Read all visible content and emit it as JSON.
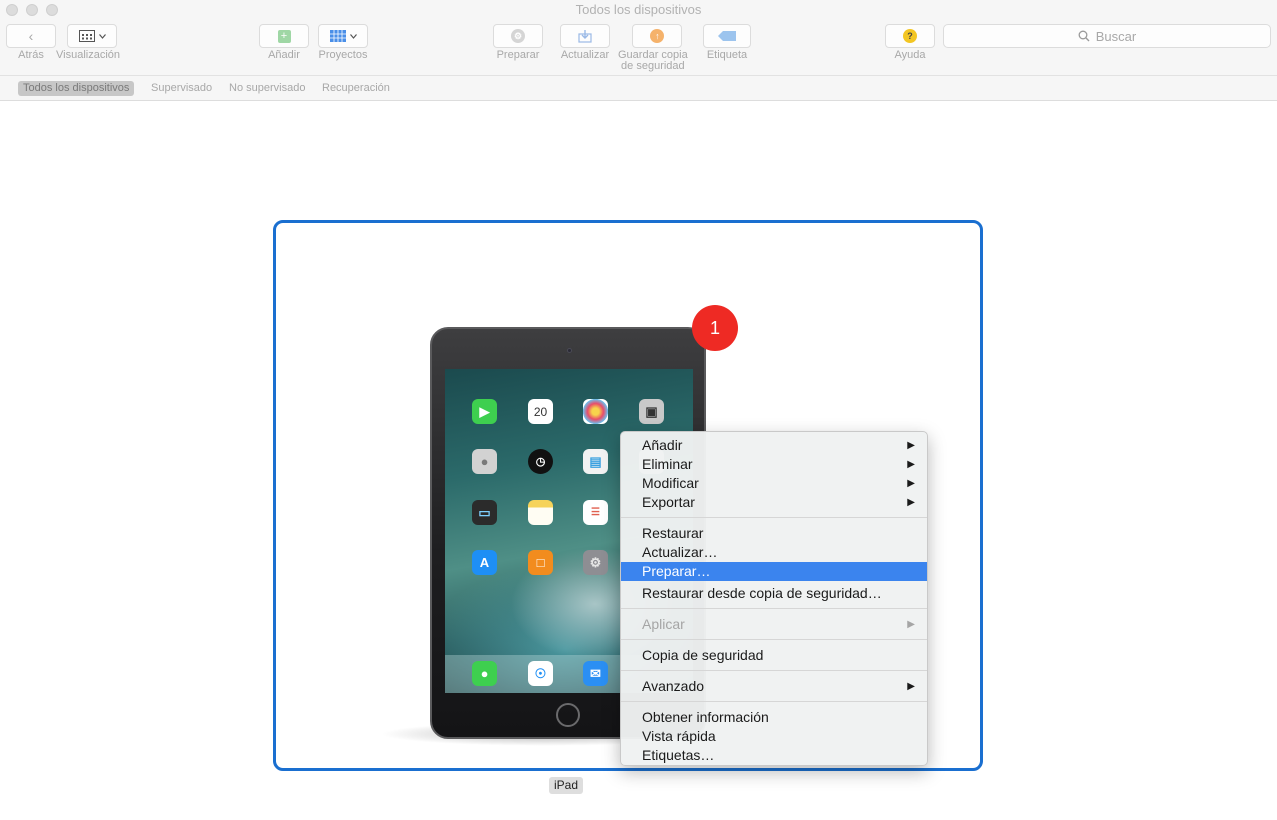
{
  "window": {
    "title": "Todos los dispositivos"
  },
  "toolbar": {
    "back_label": "Atrás",
    "view_label": "Visualización",
    "add_label": "Añadir",
    "projects_label": "Proyectos",
    "prepare_label": "Preparar",
    "update_label": "Actualizar",
    "backup_label_line1": "Guardar copia",
    "backup_label_line2": "de seguridad",
    "tag_label": "Etiqueta",
    "help_label": "Ayuda",
    "help_icon_glyph": "?",
    "search_placeholder": "Buscar"
  },
  "filters": [
    {
      "label": "Todos los dispositivos",
      "active": true
    },
    {
      "label": "Supervisado",
      "active": false
    },
    {
      "label": "No supervisado",
      "active": false
    },
    {
      "label": "Recuperación",
      "active": false
    }
  ],
  "device": {
    "name": "iPad",
    "badge": "1",
    "calendar_day": "20",
    "badge_color": "#ee2a24",
    "selection_color": "#1a6fd0"
  },
  "context_menu": {
    "items": [
      {
        "label": "Añadir",
        "submenu": true
      },
      {
        "label": "Eliminar",
        "submenu": true
      },
      {
        "label": "Modificar",
        "submenu": true
      },
      {
        "label": "Exportar",
        "submenu": true
      },
      {
        "label": "Restaurar"
      },
      {
        "label": "Actualizar…"
      },
      {
        "label": "Preparar…",
        "highlighted": true
      },
      {
        "label": "Restaurar desde copia de seguridad…"
      },
      {
        "label": "Aplicar",
        "submenu": true,
        "disabled": true
      },
      {
        "label": "Copia de seguridad"
      },
      {
        "label": "Avanzado",
        "submenu": true
      },
      {
        "label": "Obtener información"
      },
      {
        "label": "Vista rápida"
      },
      {
        "label": "Etiquetas…"
      }
    ],
    "highlight_color": "#3b84ee"
  }
}
